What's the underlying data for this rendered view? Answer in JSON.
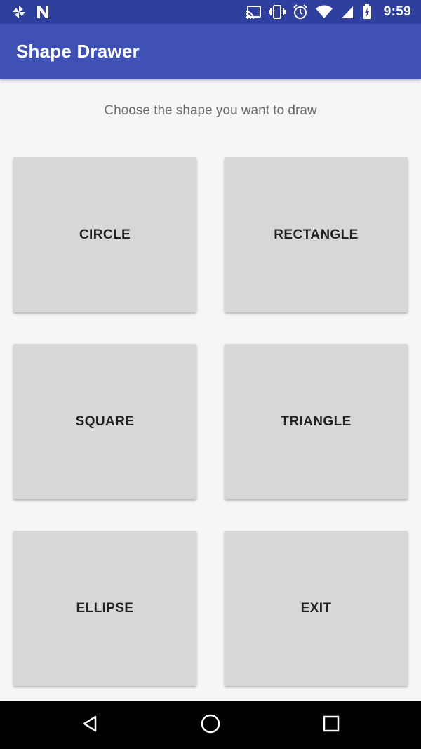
{
  "status_bar": {
    "time": "9:59",
    "icons": [
      "pinwheel-icon",
      "n-icon",
      "cast-icon",
      "vibrate-icon",
      "alarm-icon",
      "wifi-icon",
      "battery-charging-icon"
    ]
  },
  "app_bar": {
    "title": "Shape Drawer"
  },
  "main": {
    "prompt": "Choose the shape you want to draw",
    "buttons": {
      "circle": "CIRCLE",
      "rectangle": "RECTANGLE",
      "square": "SQUARE",
      "triangle": "TRIANGLE",
      "ellipse": "ELLIPSE",
      "exit": "EXIT"
    }
  },
  "nav_bar": {
    "icons": [
      "back-icon",
      "home-icon",
      "recents-icon"
    ]
  },
  "colors": {
    "status_bar": "#2f3f9e",
    "app_bar": "#3f51b5",
    "background": "#f6f5f8",
    "button": "#d7d6d9"
  }
}
